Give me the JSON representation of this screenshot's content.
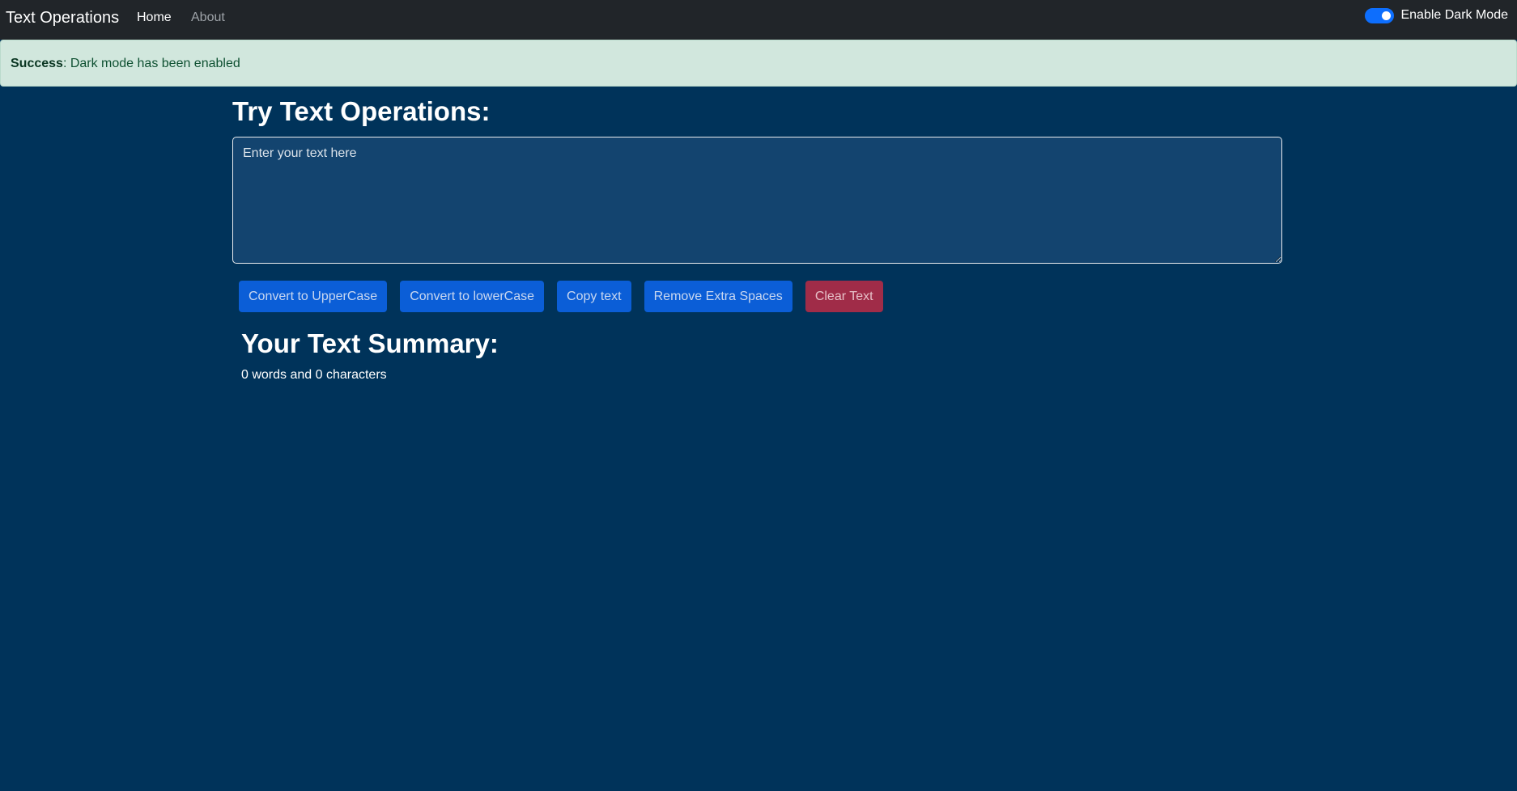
{
  "navbar": {
    "brand": "Text Operations",
    "links": [
      {
        "label": "Home",
        "active": true
      },
      {
        "label": "About",
        "active": false
      }
    ],
    "dark_mode_toggle": {
      "label": "Enable Dark Mode",
      "checked": true
    }
  },
  "alert": {
    "type": "Success",
    "message": ": Dark mode has been enabled"
  },
  "main": {
    "heading": "Try Text Operations:",
    "textarea": {
      "placeholder": "Enter your text here",
      "value": ""
    },
    "buttons": [
      {
        "label": "Convert to UpperCase"
      },
      {
        "label": "Convert to lowerCase"
      },
      {
        "label": "Copy text"
      },
      {
        "label": "Remove Extra Spaces"
      },
      {
        "label": "Clear Text"
      }
    ],
    "summary": {
      "heading": "Your Text Summary:",
      "text": "0 words and 0 characters"
    }
  },
  "colors": {
    "background": "#00335a",
    "navbar": "#212529",
    "alert_bg": "#d1e7dd",
    "primary": "#0b5ed7",
    "danger": "#a02c48"
  }
}
